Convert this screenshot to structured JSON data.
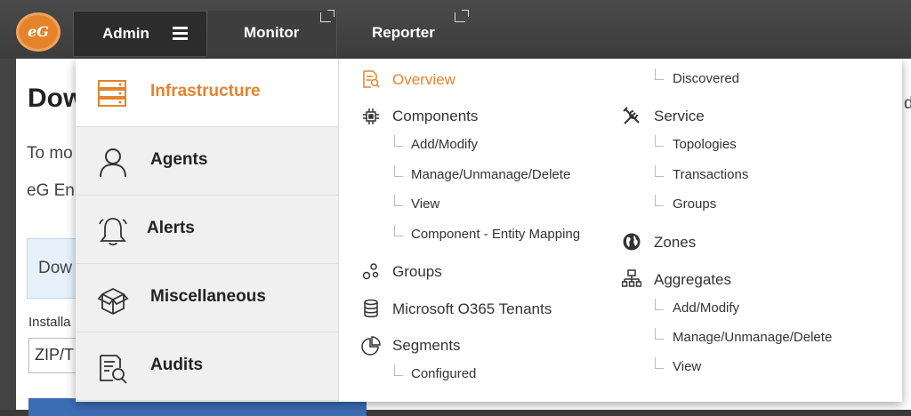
{
  "topnav": {
    "logo_text": "eG",
    "admin_label": "Admin",
    "monitor_label": "Monitor",
    "reporter_label": "Reporter"
  },
  "background_page": {
    "title": "Dow",
    "line1": "To mo",
    "line2": "eG En",
    "box_text": "Dow",
    "install_label": "Installa",
    "input_value": "ZIP/T",
    "right_char": "d"
  },
  "categories": [
    {
      "label": "Infrastructure",
      "icon": "server-icon",
      "active": true
    },
    {
      "label": "Agents",
      "icon": "user-icon"
    },
    {
      "label": "Alerts",
      "icon": "bell-icon"
    },
    {
      "label": "Miscellaneous",
      "icon": "box-icon"
    },
    {
      "label": "Audits",
      "icon": "audit-icon"
    }
  ],
  "menu_col1": {
    "overview": "Overview",
    "components": "Components",
    "components_sub": [
      "Add/Modify",
      "Manage/Unmanage/Delete",
      "View",
      "Component - Entity Mapping"
    ],
    "groups": "Groups",
    "o365": "Microsoft O365 Tenants",
    "segments": "Segments",
    "segments_sub": [
      "Configured"
    ]
  },
  "menu_col2": {
    "discovered": "Discovered",
    "service": "Service",
    "service_sub": [
      "Topologies",
      "Transactions",
      "Groups"
    ],
    "zones": "Zones",
    "aggregates": "Aggregates",
    "aggregates_sub": [
      "Add/Modify",
      "Manage/Unmanage/Delete",
      "View"
    ]
  },
  "colors": {
    "accent": "#e5832b",
    "topbar": "#3c3c3c",
    "text": "#333333"
  }
}
